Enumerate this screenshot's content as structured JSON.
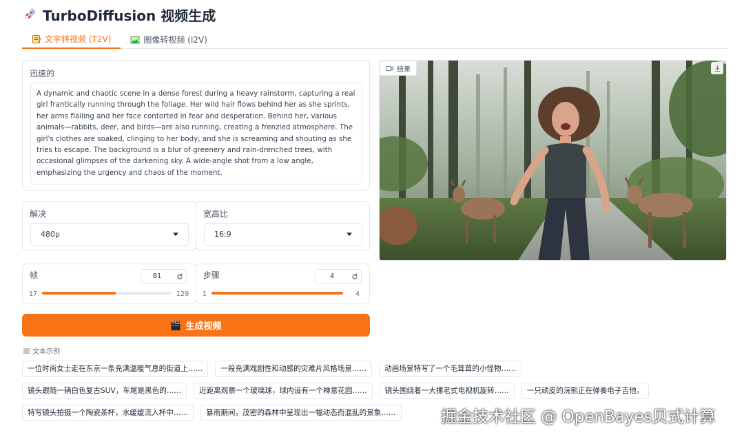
{
  "app": {
    "title": "TurboDiffusion 视频生成",
    "title_icon": "rocket-icon"
  },
  "tabs": [
    {
      "label": "文字转视频 (T2V)",
      "icon": "memo-icon",
      "active": true
    },
    {
      "label": "图像转视频 (I2V)",
      "icon": "picture-icon",
      "active": false
    }
  ],
  "prompt": {
    "label": "迅速的",
    "value": "A dynamic and chaotic scene in a dense forest during a heavy rainstorm, capturing a real girl frantically running through the foliage. Her wild hair flows behind her as she sprints, her arms flailing and her face contorted in fear and desperation. Behind her, various animals—rabbits, deer, and birds—are also running, creating a frenzied atmosphere. The girl's clothes are soaked, clinging to her body, and she is screaming and shouting as she tries to escape. The background is a blur of greenery and rain-drenched trees, with occasional glimpses of the darkening sky. A wide-angle shot from a low angle, emphasizing the urgency and chaos of the moment."
  },
  "resolution": {
    "label": "解决",
    "value": "480p"
  },
  "aspect": {
    "label": "宽高比",
    "value": "16:9"
  },
  "frames": {
    "label": "帧",
    "value": "81",
    "min": "17",
    "max": "129"
  },
  "steps": {
    "label": "步骤",
    "value": "4",
    "min": "1",
    "max": "4"
  },
  "generate_button": {
    "label": "生成视频",
    "icon": "clapper-icon"
  },
  "result": {
    "label": "结果",
    "icon": "video-icon",
    "download_icon": "download-icon"
  },
  "examples": {
    "label": "文本示例",
    "rows": [
      [
        "一位时尚女士走在东京一条充满温暖气息的街道上……",
        "一段充满戏剧性和动感的灾难片风格场景……",
        "动画场景特写了一个毛茸茸的小怪物……"
      ],
      [
        "镜头跟随一辆白色复古SUV，车尾是黑色的……",
        "近距离观察一个玻璃球，球内设有一个禅意花园……",
        "镜头围绕着一大摞老式电视机旋转……",
        "一只顽皮的浣熊正在弹奏电子吉他，"
      ],
      [
        "特写镜头拍摄一个陶瓷茶杯，水缓缓流入杯中……",
        "暴雨期间，茂密的森林中呈现出一幅动态而混乱的景象……"
      ]
    ]
  },
  "watermark": "掘金技术社区 @ OpenBayes贝式计算",
  "colors": {
    "accent": "#f97316",
    "border": "#e5e7eb"
  }
}
